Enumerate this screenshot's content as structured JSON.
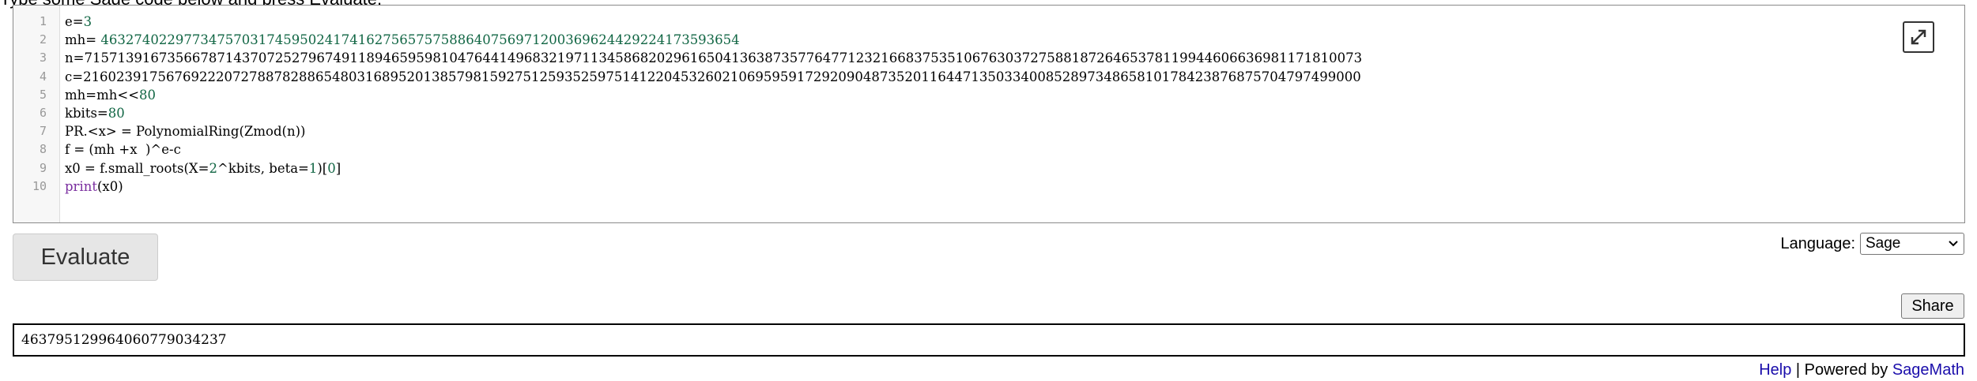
{
  "intro_text": "Type some Sage code below and press Evaluate.",
  "code_lines": [
    {
      "n": "1",
      "parts": [
        {
          "t": "e=",
          "c": ""
        },
        {
          "t": "3",
          "c": "num"
        }
      ]
    },
    {
      "n": "2",
      "parts": [
        {
          "t": "mh= ",
          "c": ""
        },
        {
          "t": "4632740229773475703174595024174162756575758864075697120036962442922417359365​4",
          "c": "num"
        }
      ]
    },
    {
      "n": "3",
      "parts": [
        {
          "t": "n=71571391673566787143707252796749118946595981047644149683219711345868202961650413638735776477123216683753510676303727588187264653781199446066369811718​10073",
          "c": ""
        }
      ]
    },
    {
      "n": "4",
      "parts": [
        {
          "t": "c=21602391756769222072788782886548031689520138579815927512593525975141220453260210695959172920904873520116447135033400852897348658101784238768757047974​99000",
          "c": ""
        }
      ]
    },
    {
      "n": "5",
      "parts": [
        {
          "t": "mh=mh<<",
          "c": ""
        },
        {
          "t": "80",
          "c": "num"
        }
      ]
    },
    {
      "n": "6",
      "parts": [
        {
          "t": "kbits=",
          "c": ""
        },
        {
          "t": "80",
          "c": "num"
        }
      ]
    },
    {
      "n": "7",
      "parts": [
        {
          "t": "PR.<x> = PolynomialRing(Zmod(n))",
          "c": ""
        }
      ]
    },
    {
      "n": "8",
      "parts": [
        {
          "t": "f = (mh +x  )^e-c",
          "c": ""
        }
      ]
    },
    {
      "n": "9",
      "parts": [
        {
          "t": "x0 = f.small_roots(X=",
          "c": ""
        },
        {
          "t": "2",
          "c": "num"
        },
        {
          "t": "^kbits, beta=",
          "c": ""
        },
        {
          "t": "1",
          "c": "num"
        },
        {
          "t": ")[",
          "c": ""
        },
        {
          "t": "0",
          "c": "num"
        },
        {
          "t": "]",
          "c": ""
        }
      ]
    },
    {
      "n": "10",
      "parts": [
        {
          "t": "print",
          "c": "kw"
        },
        {
          "t": "(x0)",
          "c": ""
        }
      ]
    }
  ],
  "buttons": {
    "evaluate": "Evaluate",
    "share": "Share"
  },
  "language": {
    "label": "Language:",
    "selected": "Sage"
  },
  "output_text": "46379512996406077903423​7",
  "footer": {
    "help": "Help",
    "separator": " | Powered by ",
    "sagemath": "SageMath"
  },
  "icons": {
    "expand": "expand-icon",
    "dropdown": "chevron-down-icon"
  }
}
